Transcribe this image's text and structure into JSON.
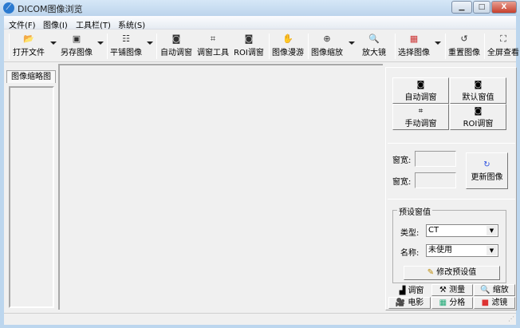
{
  "window": {
    "title": "DICOM图像浏览",
    "minimize": "▁",
    "maximize": "□",
    "close": "X"
  },
  "menu": [
    "文件(F)",
    "图像(I)",
    "工具栏(T)",
    "系统(S)"
  ],
  "toolbar": [
    {
      "label": "打开文件",
      "icon": "open-folder-icon",
      "glyph": "📂"
    },
    {
      "label": "另存图像",
      "icon": "save-icon",
      "glyph": "▣"
    },
    {
      "label": "平铺图像",
      "icon": "tile-icon",
      "glyph": "☷"
    },
    {
      "label": "自动调窗",
      "icon": "auto-window-icon",
      "glyph": "◙"
    },
    {
      "label": "调窗工具",
      "icon": "window-tool-icon",
      "glyph": "⌗"
    },
    {
      "label": "ROI调窗",
      "icon": "roi-window-icon",
      "glyph": "◙"
    },
    {
      "label": "图像漫游",
      "icon": "hand-pan-icon",
      "glyph": "✋"
    },
    {
      "label": "图像缩放",
      "icon": "zoom-icon",
      "glyph": "⊕"
    },
    {
      "label": "放大镜",
      "icon": "magnifier-icon",
      "glyph": "🔍"
    },
    {
      "label": "选择图像",
      "icon": "select-image-icon",
      "glyph": "▦"
    },
    {
      "label": "重置图像",
      "icon": "reset-image-icon",
      "glyph": "↺"
    },
    {
      "label": "全屏查看",
      "icon": "fullscreen-icon",
      "glyph": "⛶"
    }
  ],
  "left": {
    "tab": "图像缩略图"
  },
  "right": {
    "buttons": [
      "自动调窗",
      "默认窗值",
      "手动调窗",
      "ROI调窗"
    ],
    "width_label": "窗宽:",
    "level_label": "窗宽:",
    "width_value": "",
    "level_value": "",
    "update_button": "更新图像",
    "preset_group": "预设窗值",
    "type_label": "类型:",
    "type_value": "CT",
    "name_label": "名称:",
    "name_value": "未使用",
    "modify_button": "修改预设值",
    "tabs_row1": [
      "调窗",
      "测量",
      "缩放"
    ],
    "tabs_row2": [
      "电影",
      "分格",
      "滤镜"
    ]
  },
  "colors": {
    "accent": "#2b7ad0",
    "close": "#c7402d"
  }
}
